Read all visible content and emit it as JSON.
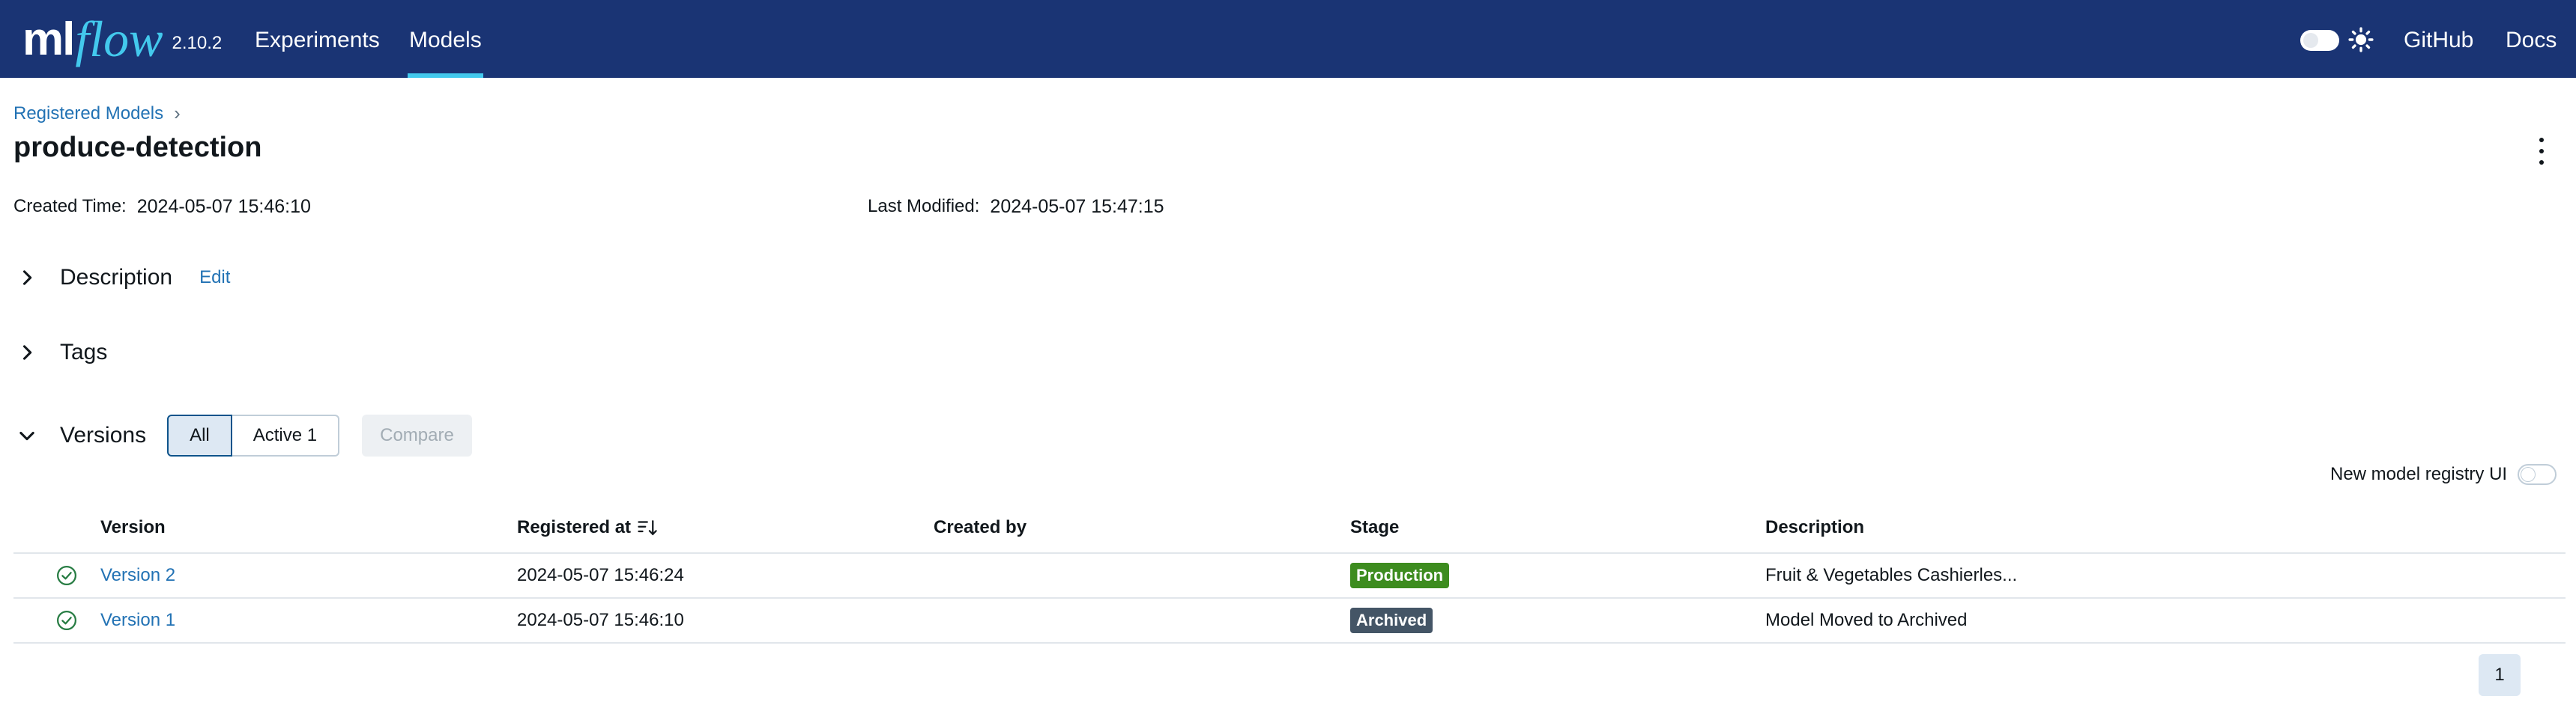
{
  "app": {
    "logo_ml": "ml",
    "logo_flow": "flow",
    "version": "2.10.2"
  },
  "nav": {
    "experiments": "Experiments",
    "models": "Models",
    "github": "GitHub",
    "docs": "Docs"
  },
  "breadcrumb": {
    "root": "Registered Models",
    "separator": "›"
  },
  "model": {
    "name": "produce-detection",
    "created_label": "Created Time:",
    "created_value": "2024-05-07 15:46:10",
    "modified_label": "Last Modified:",
    "modified_value": "2024-05-07 15:47:15"
  },
  "sections": {
    "description": "Description",
    "edit": "Edit",
    "tags": "Tags",
    "versions": "Versions"
  },
  "versions_filter": {
    "all": "All",
    "active": "Active 1",
    "compare": "Compare"
  },
  "registry_toggle": {
    "label": "New model registry UI"
  },
  "table": {
    "headers": {
      "version": "Version",
      "registered_at": "Registered at",
      "created_by": "Created by",
      "stage": "Stage",
      "description": "Description"
    },
    "rows": [
      {
        "version": "Version 2",
        "registered_at": "2024-05-07 15:46:24",
        "created_by": "",
        "stage": "Production",
        "description": "Fruit & Vegetables Cashierles..."
      },
      {
        "version": "Version 1",
        "registered_at": "2024-05-07 15:46:10",
        "created_by": "",
        "stage": "Archived",
        "description": "Model Moved to Archived"
      }
    ]
  },
  "pagination": {
    "current_page": "1"
  },
  "colors": {
    "nav_bg": "#1a3474",
    "accent": "#43c9ed",
    "link": "#2272b4",
    "production": "#3d8c1f",
    "archived": "#445566"
  }
}
